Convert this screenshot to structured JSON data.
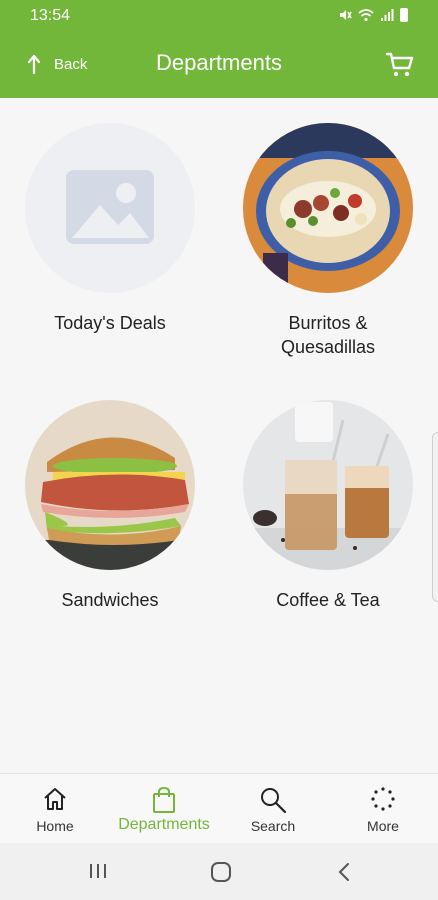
{
  "status_bar": {
    "time": "13:54"
  },
  "header": {
    "back_label": "Back",
    "title": "Departments"
  },
  "departments": [
    {
      "label": "Today's Deals",
      "image": "placeholder-image-icon"
    },
    {
      "label": "Burritos &\nQuesadillas",
      "image": "burrito-photo"
    },
    {
      "label": "Sandwiches",
      "image": "sandwich-photo"
    },
    {
      "label": "Coffee & Tea",
      "image": "iced-coffee-photo"
    }
  ],
  "bottom_nav": {
    "items": [
      {
        "label": "Home",
        "icon": "home-icon"
      },
      {
        "label": "Departments",
        "icon": "shopping-bag-icon",
        "active": true
      },
      {
        "label": "Search",
        "icon": "search-icon"
      },
      {
        "label": "More",
        "icon": "more-icon"
      }
    ]
  },
  "colors": {
    "brand_green": "#73b73a",
    "background": "#f6f6f6"
  }
}
